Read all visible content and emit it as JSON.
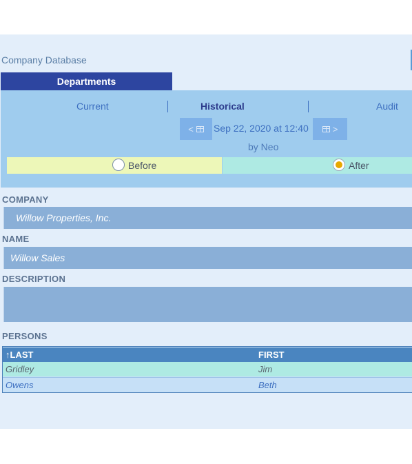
{
  "app": {
    "title": "Company Database"
  },
  "main_tab": {
    "label": "Departments"
  },
  "mode_tabs": [
    {
      "label": "Current",
      "active": false
    },
    {
      "label": "Historical",
      "active": true
    },
    {
      "label": "Audit",
      "active": false
    }
  ],
  "history": {
    "prev_label": "<",
    "next_label": ">",
    "date": "Sep 22, 2020 at 12:40",
    "by": "by Neo",
    "before_label": "Before",
    "after_label": "After",
    "selected": "After"
  },
  "form": {
    "company": {
      "label": "COMPANY",
      "value": "Willow Properties, Inc."
    },
    "name": {
      "label": "NAME",
      "value": "Willow Sales"
    },
    "description": {
      "label": "DESCRIPTION",
      "value": ""
    }
  },
  "persons": {
    "label": "PERSONS",
    "columns": [
      "↑LAST",
      "FIRST"
    ],
    "rows": [
      {
        "last": "Gridley",
        "first": "Jim"
      },
      {
        "last": "Owens",
        "first": "Beth"
      }
    ]
  },
  "colors": {
    "accent": "#2d45a0",
    "panel": "#9fccee",
    "background": "#e3eefa",
    "field": "#8aafd7",
    "header": "#4a85c0",
    "before": "#edf7b8",
    "after": "#aeeae3",
    "selected_row": "#aeeae3",
    "radio_checked": "#e8a800"
  }
}
